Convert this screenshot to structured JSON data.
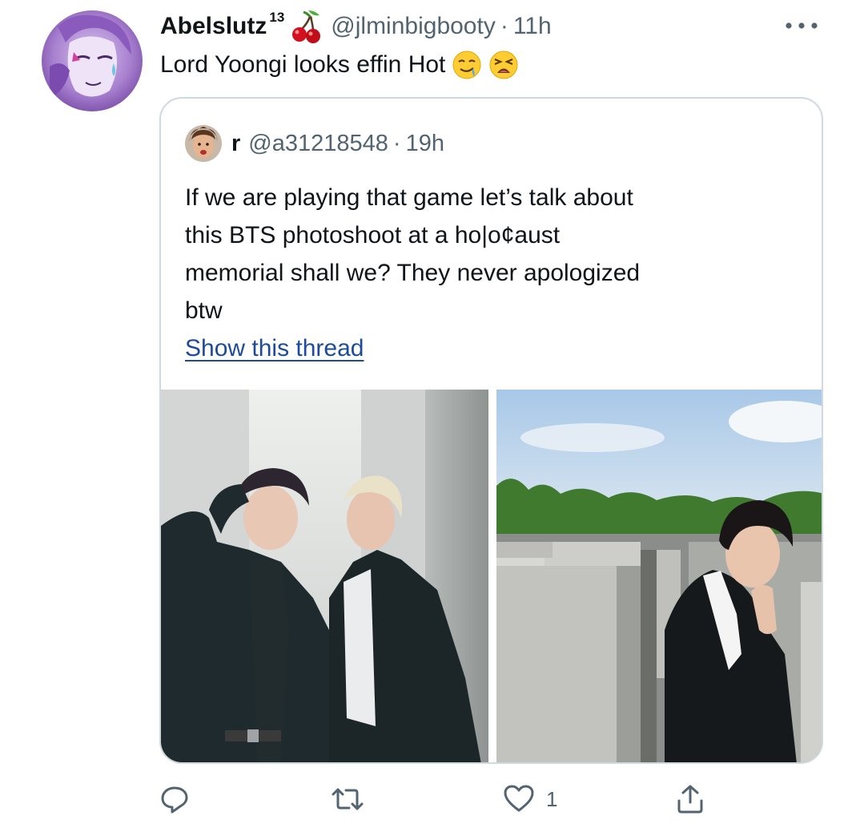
{
  "tweet": {
    "display_name": "Abelslutz",
    "superscript": "13",
    "handle": "@jlminbigbooty",
    "separator": "·",
    "time": "11h",
    "text": "Lord Yoongi looks effin Hot",
    "emojis": [
      "drooling-face",
      "weary-face"
    ]
  },
  "quoted": {
    "display_name": "r",
    "handle": "@a31218548",
    "separator": "·",
    "time": "19h",
    "lines": [
      "If we are playing that game let’s talk about",
      "this BTS photoshoot at a ho|o¢aust",
      "memorial shall we? They never apologized",
      "btw"
    ],
    "show_thread": "Show this thread"
  },
  "actions": {
    "reply_icon": "reply-icon",
    "retweet_icon": "retweet-icon",
    "like_icon": "heart-icon",
    "like_count": "1",
    "share_icon": "share-icon"
  },
  "colors": {
    "text": "#0f1419",
    "secondary": "#536471",
    "border": "#cfd9de",
    "link": "#1d4b9a"
  }
}
